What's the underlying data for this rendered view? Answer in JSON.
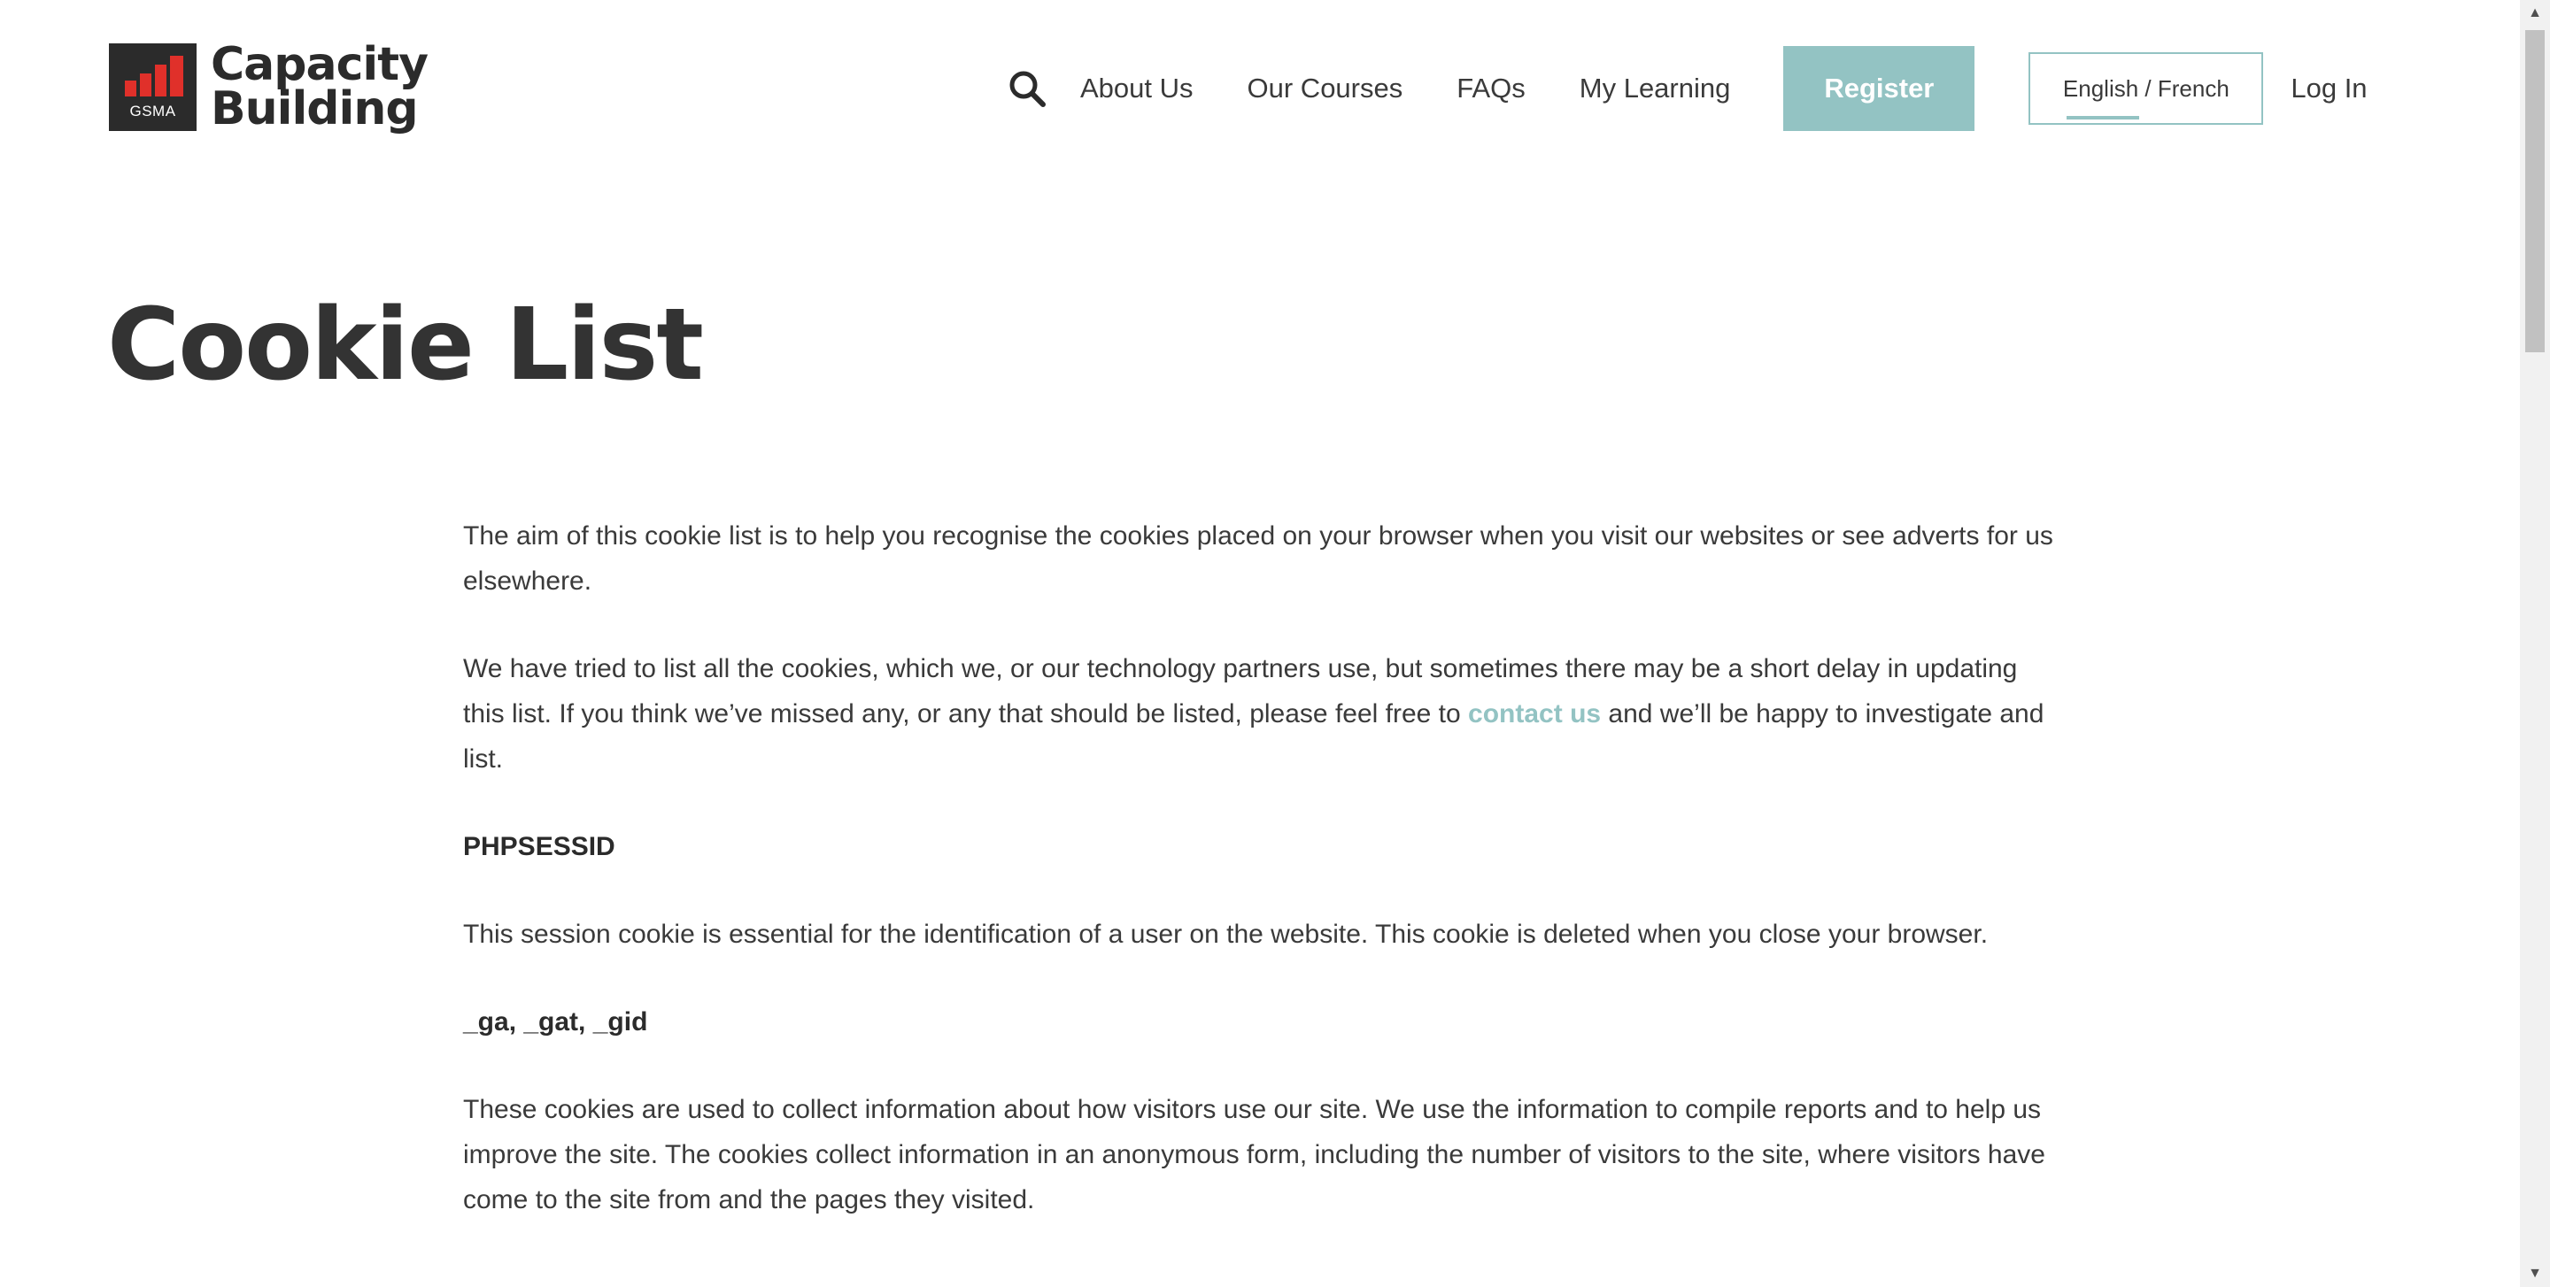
{
  "header": {
    "logo_brand": "GSMA",
    "logo_line1": "Capacity",
    "logo_line2": "Building",
    "nav": {
      "search_icon": "search-icon",
      "about": "About Us",
      "courses": "Our Courses",
      "faqs": "FAQs",
      "my_learning": "My Learning",
      "register": "Register",
      "language": "English / French",
      "login": "Log In"
    }
  },
  "page": {
    "title": "Cookie List",
    "intro": "The aim of this cookie list is to help you recognise the cookies placed on your browser when you visit our websites or see adverts for us elsewhere.",
    "para2_before": "We have tried to list all the cookies, which we, or our technology partners use, but sometimes there may be a short delay in updating this list. If you think we’ve missed any, or any that should be listed, please feel free to ",
    "para2_link": "contact us",
    "para2_after": " and we’ll be happy to investigate and list.",
    "cookies": [
      {
        "name": "PHPSESSID",
        "description": "This session cookie is essential for the identification of a user on the website. This cookie is deleted when you close your browser."
      },
      {
        "name": "_ga, _gat, _gid",
        "description": "These cookies are used to collect information about how visitors use our site. We use the information to compile reports and to help us improve the site. The cookies collect information in an anonymous form, including the number of visitors to the site, where visitors have come to the site from and the pages they visited."
      }
    ]
  },
  "colors": {
    "accent": "#93c3c3",
    "text": "#3a3a3a",
    "logo_bg": "#2b2b2b",
    "logo_red": "#e0302a"
  }
}
